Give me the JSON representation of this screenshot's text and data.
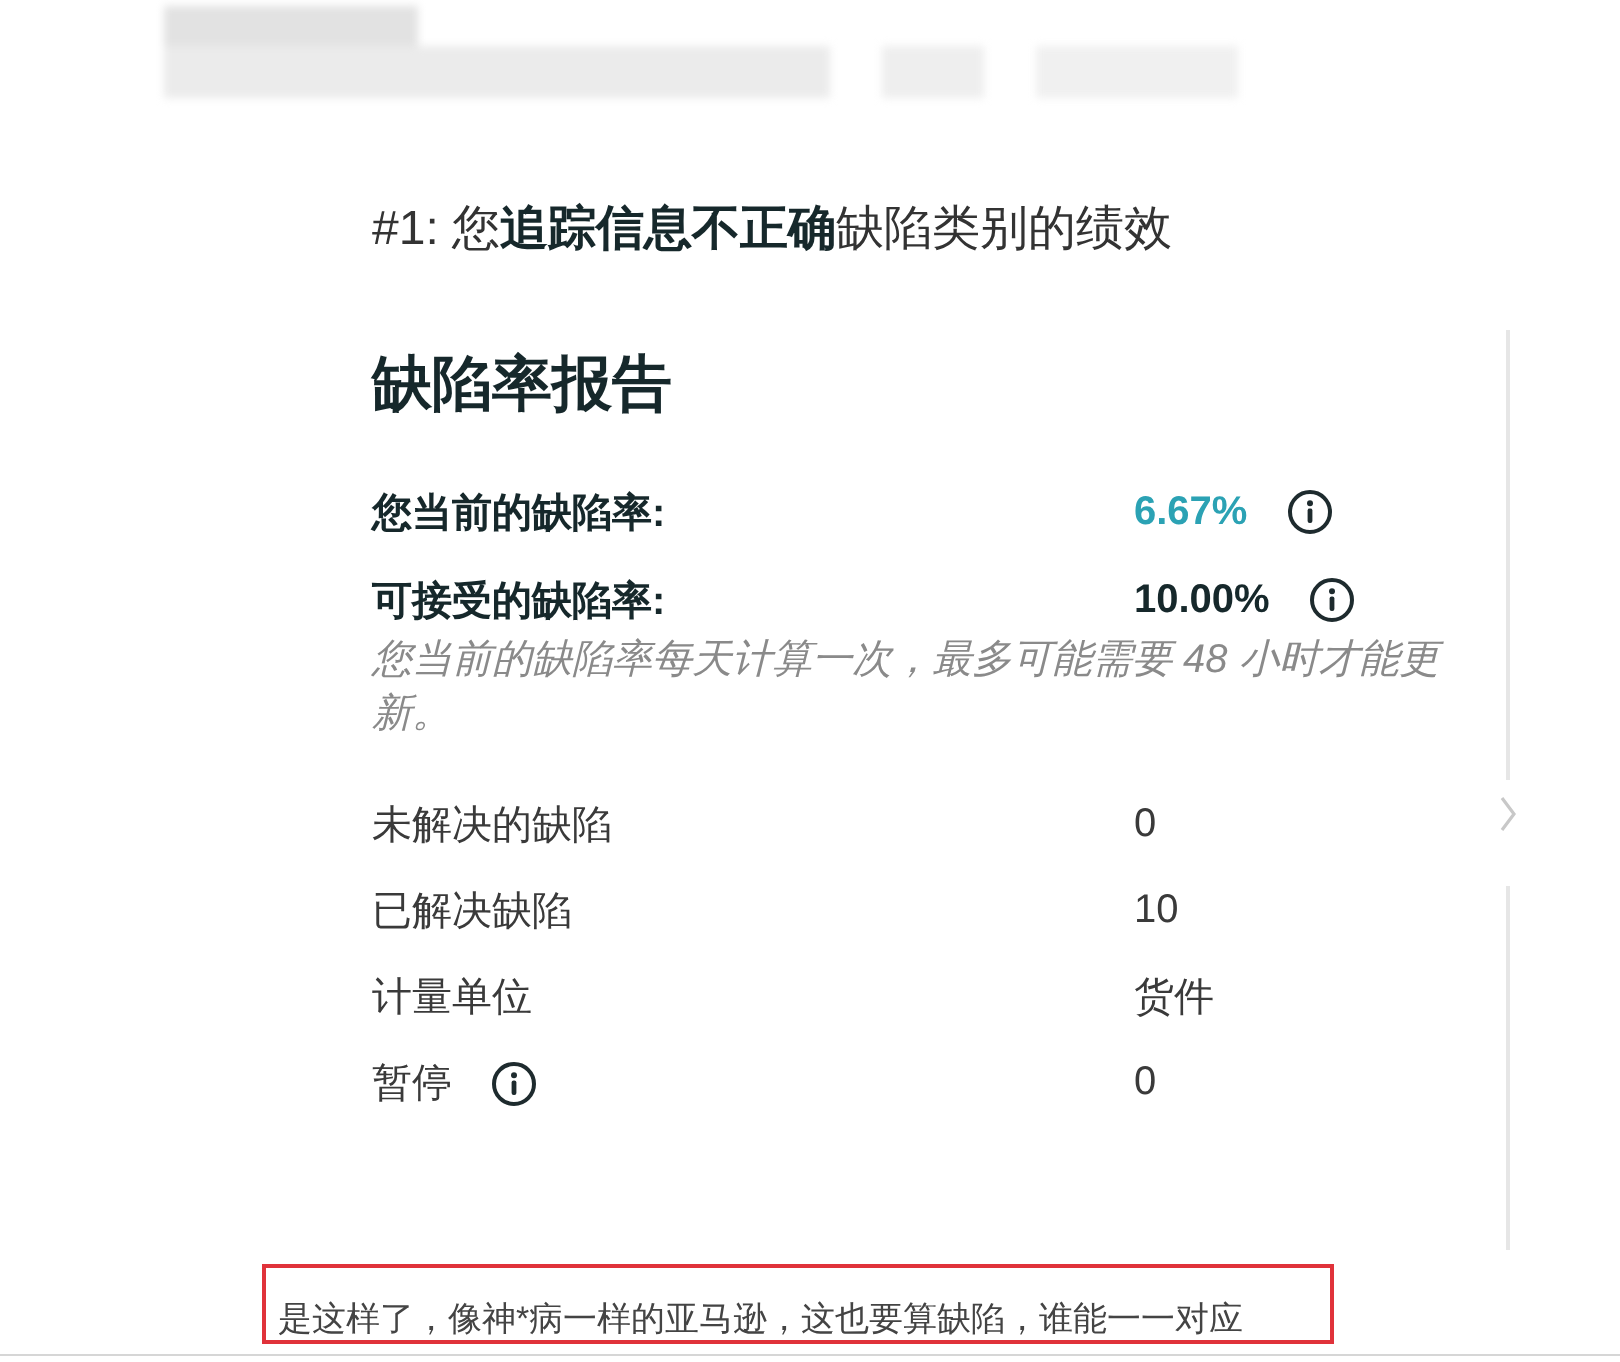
{
  "heading": "#1: 您**追踪信息不正确**缺陷类别的绩效",
  "report": {
    "title": "缺陷率报告",
    "rates": [
      {
        "label": "您当前的缺陷率:",
        "value": "6.67%",
        "kind": "current",
        "info": true
      },
      {
        "label": "可接受的缺陷率:",
        "value": "10.00%",
        "kind": "target",
        "info": true
      }
    ],
    "note": "您当前的缺陷率每天计算一次，最多可能需要 48 小时才能更新。",
    "stats": [
      {
        "label": "未解决的缺陷",
        "value": "0",
        "info": false
      },
      {
        "label": "已解决缺陷",
        "value": "10",
        "info": false
      },
      {
        "label": "计量单位",
        "value": "货件",
        "info": false
      },
      {
        "label": "暂停",
        "value": "0",
        "info": true
      }
    ]
  },
  "annotation": {
    "text": "是这样了，像神*病一样的亚马逊，这也要算缺陷，谁能一一对应"
  }
}
